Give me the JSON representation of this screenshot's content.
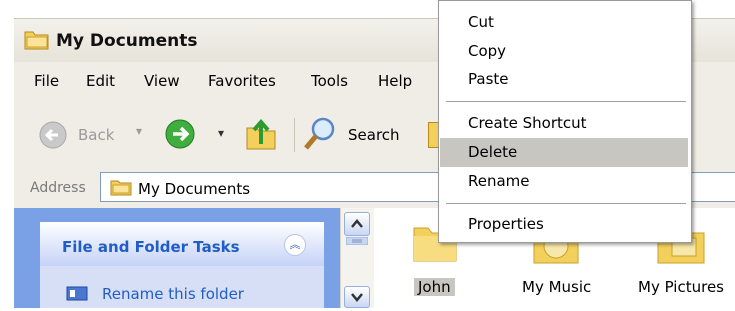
{
  "window": {
    "title": "My Documents"
  },
  "menu": [
    "File",
    "Edit",
    "View",
    "Favorites",
    "Tools",
    "Help"
  ],
  "toolbar": {
    "back_label": "Back",
    "search_label": "Search"
  },
  "address": {
    "label": "Address",
    "value": "My Documents"
  },
  "task_pane": {
    "title": "File and Folder Tasks",
    "chevron": "»",
    "links": [
      "Rename this folder"
    ]
  },
  "folders": [
    {
      "label": "John",
      "selected": true
    },
    {
      "label": "My Music",
      "selected": false
    },
    {
      "label": "My Pictures",
      "selected": false
    }
  ],
  "context_menu": {
    "items": [
      "Cut",
      "Copy",
      "Paste",
      "Create Shortcut",
      "Delete",
      "Rename",
      "Properties"
    ],
    "highlighted": "Delete"
  },
  "colors": {
    "task_pane_bg": "#7aa1e6",
    "link_blue": "#215dc6",
    "highlight": "#c8c6c0"
  }
}
